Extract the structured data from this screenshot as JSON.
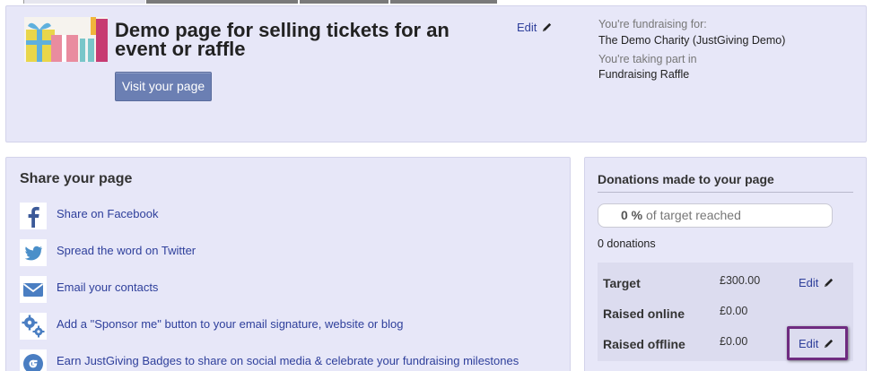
{
  "header": {
    "title": "Demo page for selling tickets for an event or raffle",
    "edit_label": "Edit",
    "visit_button": "Visit your page",
    "fundraising_for_label": "You're fundraising for:",
    "fundraising_for_value": "The Demo Charity (JustGiving Demo)",
    "taking_part_label": "You're taking part in",
    "taking_part_value": "Fundraising Raffle"
  },
  "share": {
    "title": "Share your page",
    "items": [
      {
        "label": "Share on Facebook",
        "icon": "facebook-icon"
      },
      {
        "label": "Spread the word on Twitter",
        "icon": "twitter-icon"
      },
      {
        "label": "Email your contacts",
        "icon": "email-icon"
      },
      {
        "label": "Add a \"Sponsor me\" button to your email signature, website or blog",
        "icon": "gears-icon"
      },
      {
        "label": "Earn JustGiving Badges to share on social media & celebrate your fundraising milestones",
        "icon": "justgiving-badge-icon"
      }
    ]
  },
  "donations": {
    "title": "Donations made to your page",
    "percent": "0 %",
    "percent_suffix": "of target reached",
    "count": "0 donations",
    "rows": [
      {
        "label": "Target",
        "value": "£300.00",
        "edit": "Edit"
      },
      {
        "label": "Raised online",
        "value": "£0.00"
      },
      {
        "label": "Raised offline",
        "value": "£0.00",
        "edit": "Edit"
      }
    ]
  },
  "colors": {
    "panel_bg": "#e7e7f8",
    "link": "#2e3f9b",
    "button": "#6b7fb3",
    "highlight": "#6f2b80"
  }
}
